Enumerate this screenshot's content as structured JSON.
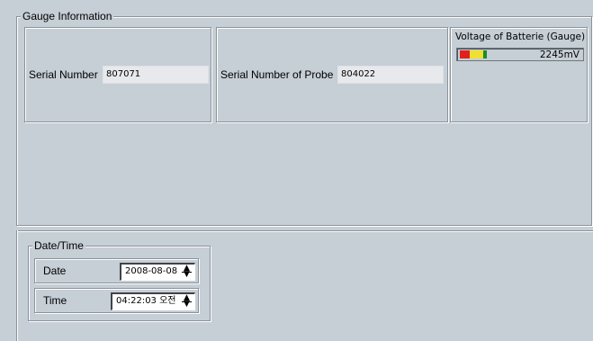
{
  "gauge_info": {
    "title": "Gauge Information",
    "serial_number_label": "Serial Number",
    "serial_number_value": "807071",
    "probe_serial_label": "Serial Number of Probe",
    "probe_serial_value": "804022",
    "battery_label": "Voltage of Batterie (Gauge)",
    "battery_value": "2245mV"
  },
  "datetime": {
    "title": "Date/Time",
    "date_label": "Date",
    "date_value": "2008-08-08",
    "time_label": "Time",
    "time_value": "04:22:03 오전"
  },
  "colors": {
    "background": "#c6ced6",
    "battery_red": "#e0201c",
    "battery_yellow": "#f0e030",
    "battery_green": "#1c8a2c"
  }
}
